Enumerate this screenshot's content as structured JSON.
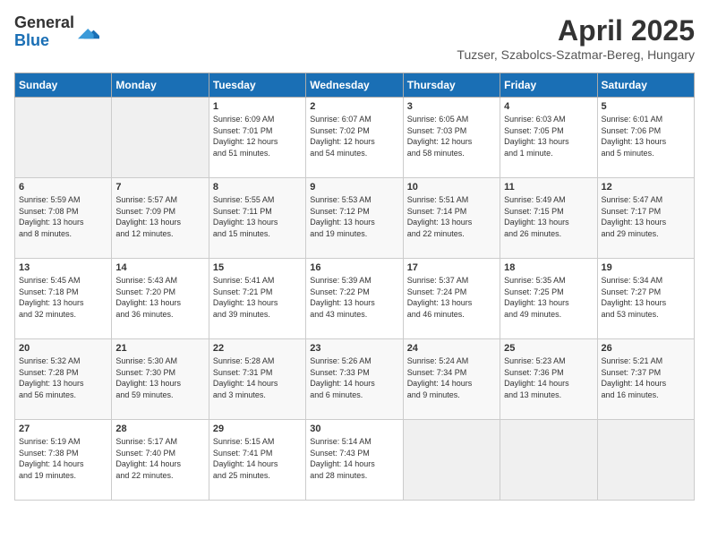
{
  "logo": {
    "general": "General",
    "blue": "Blue"
  },
  "title": "April 2025",
  "subtitle": "Tuzser, Szabolcs-Szatmar-Bereg, Hungary",
  "days_of_week": [
    "Sunday",
    "Monday",
    "Tuesday",
    "Wednesday",
    "Thursday",
    "Friday",
    "Saturday"
  ],
  "weeks": [
    [
      {
        "day": "",
        "info": ""
      },
      {
        "day": "",
        "info": ""
      },
      {
        "day": "1",
        "info": "Sunrise: 6:09 AM\nSunset: 7:01 PM\nDaylight: 12 hours\nand 51 minutes."
      },
      {
        "day": "2",
        "info": "Sunrise: 6:07 AM\nSunset: 7:02 PM\nDaylight: 12 hours\nand 54 minutes."
      },
      {
        "day": "3",
        "info": "Sunrise: 6:05 AM\nSunset: 7:03 PM\nDaylight: 12 hours\nand 58 minutes."
      },
      {
        "day": "4",
        "info": "Sunrise: 6:03 AM\nSunset: 7:05 PM\nDaylight: 13 hours\nand 1 minute."
      },
      {
        "day": "5",
        "info": "Sunrise: 6:01 AM\nSunset: 7:06 PM\nDaylight: 13 hours\nand 5 minutes."
      }
    ],
    [
      {
        "day": "6",
        "info": "Sunrise: 5:59 AM\nSunset: 7:08 PM\nDaylight: 13 hours\nand 8 minutes."
      },
      {
        "day": "7",
        "info": "Sunrise: 5:57 AM\nSunset: 7:09 PM\nDaylight: 13 hours\nand 12 minutes."
      },
      {
        "day": "8",
        "info": "Sunrise: 5:55 AM\nSunset: 7:11 PM\nDaylight: 13 hours\nand 15 minutes."
      },
      {
        "day": "9",
        "info": "Sunrise: 5:53 AM\nSunset: 7:12 PM\nDaylight: 13 hours\nand 19 minutes."
      },
      {
        "day": "10",
        "info": "Sunrise: 5:51 AM\nSunset: 7:14 PM\nDaylight: 13 hours\nand 22 minutes."
      },
      {
        "day": "11",
        "info": "Sunrise: 5:49 AM\nSunset: 7:15 PM\nDaylight: 13 hours\nand 26 minutes."
      },
      {
        "day": "12",
        "info": "Sunrise: 5:47 AM\nSunset: 7:17 PM\nDaylight: 13 hours\nand 29 minutes."
      }
    ],
    [
      {
        "day": "13",
        "info": "Sunrise: 5:45 AM\nSunset: 7:18 PM\nDaylight: 13 hours\nand 32 minutes."
      },
      {
        "day": "14",
        "info": "Sunrise: 5:43 AM\nSunset: 7:20 PM\nDaylight: 13 hours\nand 36 minutes."
      },
      {
        "day": "15",
        "info": "Sunrise: 5:41 AM\nSunset: 7:21 PM\nDaylight: 13 hours\nand 39 minutes."
      },
      {
        "day": "16",
        "info": "Sunrise: 5:39 AM\nSunset: 7:22 PM\nDaylight: 13 hours\nand 43 minutes."
      },
      {
        "day": "17",
        "info": "Sunrise: 5:37 AM\nSunset: 7:24 PM\nDaylight: 13 hours\nand 46 minutes."
      },
      {
        "day": "18",
        "info": "Sunrise: 5:35 AM\nSunset: 7:25 PM\nDaylight: 13 hours\nand 49 minutes."
      },
      {
        "day": "19",
        "info": "Sunrise: 5:34 AM\nSunset: 7:27 PM\nDaylight: 13 hours\nand 53 minutes."
      }
    ],
    [
      {
        "day": "20",
        "info": "Sunrise: 5:32 AM\nSunset: 7:28 PM\nDaylight: 13 hours\nand 56 minutes."
      },
      {
        "day": "21",
        "info": "Sunrise: 5:30 AM\nSunset: 7:30 PM\nDaylight: 13 hours\nand 59 minutes."
      },
      {
        "day": "22",
        "info": "Sunrise: 5:28 AM\nSunset: 7:31 PM\nDaylight: 14 hours\nand 3 minutes."
      },
      {
        "day": "23",
        "info": "Sunrise: 5:26 AM\nSunset: 7:33 PM\nDaylight: 14 hours\nand 6 minutes."
      },
      {
        "day": "24",
        "info": "Sunrise: 5:24 AM\nSunset: 7:34 PM\nDaylight: 14 hours\nand 9 minutes."
      },
      {
        "day": "25",
        "info": "Sunrise: 5:23 AM\nSunset: 7:36 PM\nDaylight: 14 hours\nand 13 minutes."
      },
      {
        "day": "26",
        "info": "Sunrise: 5:21 AM\nSunset: 7:37 PM\nDaylight: 14 hours\nand 16 minutes."
      }
    ],
    [
      {
        "day": "27",
        "info": "Sunrise: 5:19 AM\nSunset: 7:38 PM\nDaylight: 14 hours\nand 19 minutes."
      },
      {
        "day": "28",
        "info": "Sunrise: 5:17 AM\nSunset: 7:40 PM\nDaylight: 14 hours\nand 22 minutes."
      },
      {
        "day": "29",
        "info": "Sunrise: 5:15 AM\nSunset: 7:41 PM\nDaylight: 14 hours\nand 25 minutes."
      },
      {
        "day": "30",
        "info": "Sunrise: 5:14 AM\nSunset: 7:43 PM\nDaylight: 14 hours\nand 28 minutes."
      },
      {
        "day": "",
        "info": ""
      },
      {
        "day": "",
        "info": ""
      },
      {
        "day": "",
        "info": ""
      }
    ]
  ]
}
